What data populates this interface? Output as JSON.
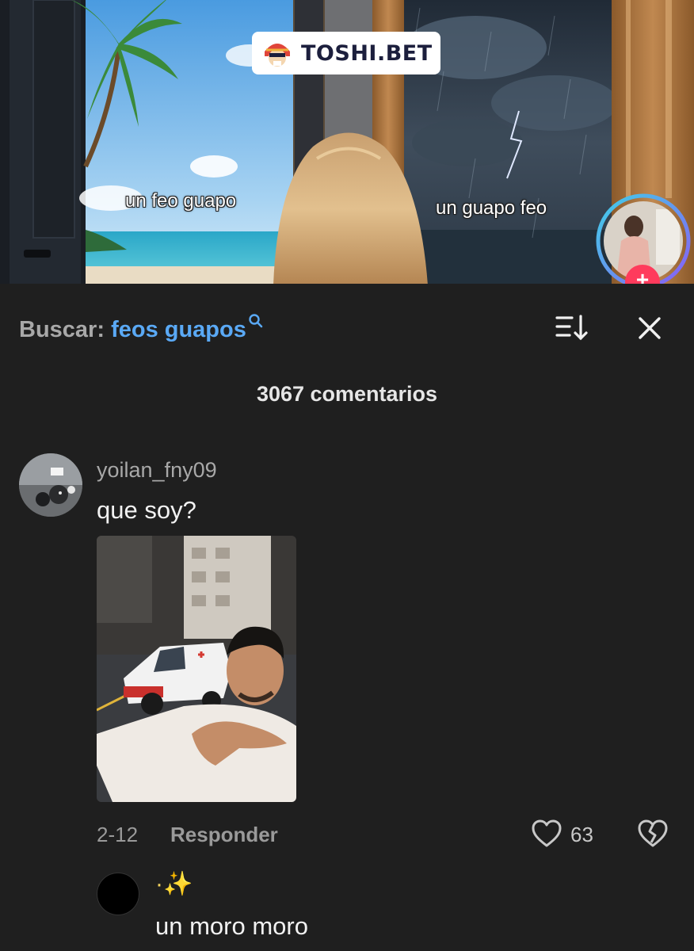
{
  "video": {
    "brand": "TOSHI.BET",
    "caption_left": "un feo guapo",
    "caption_right": "un guapo feo",
    "follow_symbol": "+"
  },
  "search": {
    "label": "Buscar:",
    "query": "feos guapos",
    "query_icon": "search-icon"
  },
  "header": {
    "sort_icon": "sort-icon",
    "close_icon": "close-icon",
    "count": "3067 comentarios"
  },
  "comment": {
    "username": "yoilan_fny09",
    "text": "que soy?",
    "date": "2-12",
    "reply_label": "Responder",
    "likes": "63"
  },
  "reply": {
    "username": "·✨",
    "text": "un moro moro"
  },
  "colors": {
    "background": "#1f1f1f",
    "search_query": "#5aa9f5",
    "follow_button": "#ff3b5c",
    "avatar_ring_a": "#3fd0e8",
    "avatar_ring_b": "#8a5cf5"
  }
}
